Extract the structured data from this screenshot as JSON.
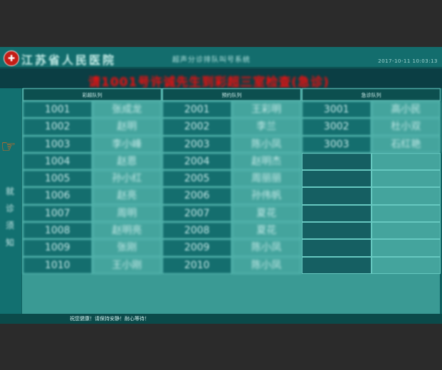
{
  "header": {
    "logo_glyph": "✚",
    "hospital_name": "江苏省人民医院",
    "system_name": "超声分诊排队叫号系统",
    "datetime": "2017-10-11 10:03:13"
  },
  "call_message": "请1001号许诚先生到彩超三室检查(急诊)",
  "side": {
    "pointer_icon": "hand-pointing-icon",
    "text": "就诊须知"
  },
  "queues": [
    {
      "title": "彩超队列",
      "rows": [
        {
          "number": "1001",
          "name": "张成龙"
        },
        {
          "number": "1002",
          "name": "赵明"
        },
        {
          "number": "1003",
          "name": "李小峰"
        },
        {
          "number": "1004",
          "name": "赵恩"
        },
        {
          "number": "1005",
          "name": "孙小红"
        },
        {
          "number": "1006",
          "name": "赵亮"
        },
        {
          "number": "1007",
          "name": "周明"
        },
        {
          "number": "1008",
          "name": "赵明亮"
        },
        {
          "number": "1009",
          "name": "张刚"
        },
        {
          "number": "1010",
          "name": "王小刚"
        }
      ]
    },
    {
      "title": "预约队列",
      "rows": [
        {
          "number": "2001",
          "name": "王彩明"
        },
        {
          "number": "2002",
          "name": "李兰"
        },
        {
          "number": "2003",
          "name": "陈小凤"
        },
        {
          "number": "2004",
          "name": "赵明杰"
        },
        {
          "number": "2005",
          "name": "周丽丽"
        },
        {
          "number": "2006",
          "name": "孙伟帆"
        },
        {
          "number": "2007",
          "name": "夏花"
        },
        {
          "number": "2008",
          "name": "夏花"
        },
        {
          "number": "2009",
          "name": "陈小凤"
        },
        {
          "number": "2010",
          "name": "陈小凤"
        }
      ]
    },
    {
      "title": "急诊队列",
      "rows": [
        {
          "number": "3001",
          "name": "高小民"
        },
        {
          "number": "3002",
          "name": "杜小双"
        },
        {
          "number": "3003",
          "name": "石红艳"
        },
        {
          "number": "",
          "name": ""
        },
        {
          "number": "",
          "name": ""
        },
        {
          "number": "",
          "name": ""
        },
        {
          "number": "",
          "name": ""
        },
        {
          "number": "",
          "name": ""
        },
        {
          "number": "",
          "name": ""
        },
        {
          "number": "",
          "name": ""
        }
      ]
    }
  ],
  "footer": {
    "message": "祝您健康！请保持安静！耐心等待！"
  }
}
